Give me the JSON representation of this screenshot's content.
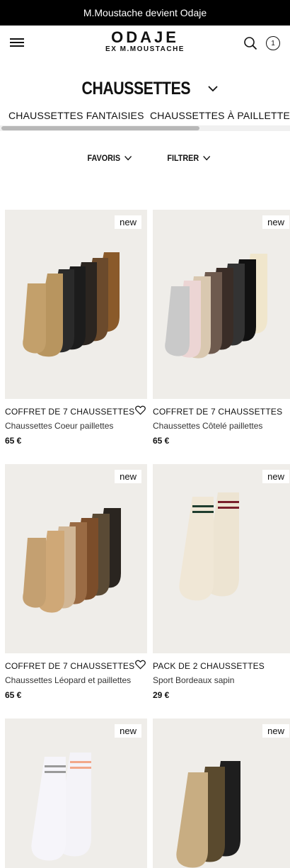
{
  "banner": {
    "text": "M.Moustache devient Odaje"
  },
  "brand": {
    "name": "ODAJE",
    "sub": "EX M.MOUSTACHE"
  },
  "cart": {
    "count": "1"
  },
  "category": {
    "title": "CHAUSSETTES"
  },
  "subcategories": [
    "CHAUSSETTES FANTAISIES",
    "CHAUSSETTES À PAILLETTES"
  ],
  "filters": {
    "sort": "FAVORIS",
    "filter": "FILTRER"
  },
  "products": [
    {
      "badge": "new",
      "name": "COFFRET DE 7 CHAUSSETTES",
      "desc": "Chaussettes Coeur paillettes",
      "price": "65 €"
    },
    {
      "badge": "new",
      "name": "COFFRET DE 7 CHAUSSETTES",
      "desc": "Chaussettes Côtelé paillettes",
      "price": "65 €"
    },
    {
      "badge": "new",
      "name": "COFFRET DE 7 CHAUSSETTES",
      "desc": "Chaussettes Léopard et paillettes",
      "price": "65 €"
    },
    {
      "badge": "new",
      "name": "PACK DE 2 CHAUSSETTES",
      "desc": "Sport Bordeaux sapin",
      "price": "29 €"
    },
    {
      "badge": "new",
      "name": "",
      "desc": "",
      "price": ""
    },
    {
      "badge": "new",
      "name": "",
      "desc": "",
      "price": ""
    }
  ],
  "colors": {
    "banner_bg": "#000000",
    "image_bg": "#efede9",
    "accent_text": "#111111"
  }
}
